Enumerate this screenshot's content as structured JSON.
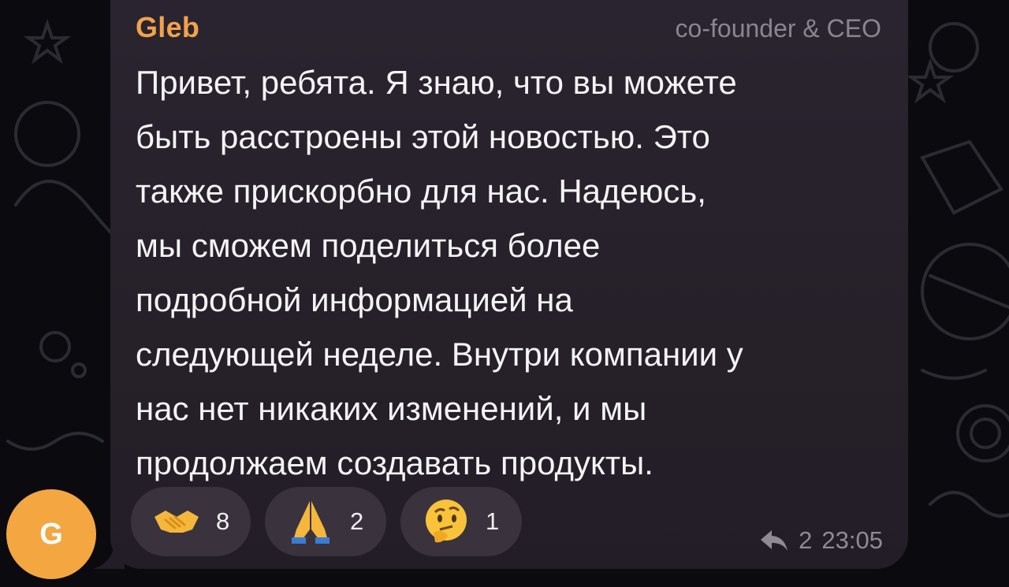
{
  "message": {
    "sender_name": "Gleb",
    "sender_role": "co-founder & CEO",
    "text": "Привет, ребята. Я знаю, что вы можете\nбыть расстроены этой новостью. Это\nтакже прискорбно для нас. Надеюсь,\nмы сможем поделиться более\nподробной информацией на\nследующей неделе. Внутри компании у\nнас нет никаких изменений, и мы\nпродолжаем создавать продукты.",
    "reply_count": "2",
    "time": "23:05"
  },
  "avatar": {
    "initial": "G",
    "color": "#f4a640"
  },
  "reactions": [
    {
      "emoji_name": "handshake-icon",
      "count": "8"
    },
    {
      "emoji_name": "folded-hands-icon",
      "count": "2"
    },
    {
      "emoji_name": "thinking-face-icon",
      "count": "1"
    }
  ],
  "colors": {
    "bubble": "#262029",
    "sender_name": "#f2a24a",
    "reaction_pill": "#3a333e",
    "background": "#0b0b0f"
  }
}
